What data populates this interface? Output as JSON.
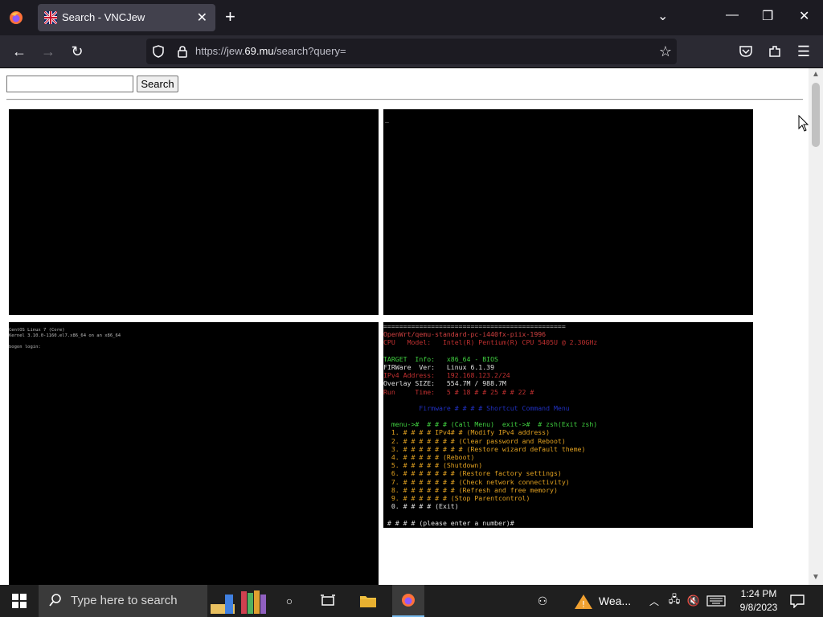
{
  "browser": {
    "tab_title": "Search - VNCJew",
    "url_prefix": "https://jew.",
    "url_domain": "69.mu",
    "url_path": "/search?query="
  },
  "page": {
    "search_input_value": "",
    "search_button_label": "Search"
  },
  "screenshots": {
    "centos_lines": [
      "CentOS Linux 7 (Core)",
      "Kernel 3.10.0-1160.el7.x86_64 on an x86_64",
      "",
      "bogon login:"
    ],
    "openwrt_lines": [
      {
        "text": "==============================================",
        "color": "#bbbbbb"
      },
      {
        "text": "OpenWrt/qemu-standard-pc-i440fx-piix-1996",
        "color": "#d04040"
      },
      {
        "text": "CPU   Model:   Intel(R) Pentium(R) CPU 5405U @ 2.30GHz",
        "color": "#c03030"
      },
      {
        "text": "                      ",
        "color": "#2020c0"
      },
      {
        "text": "TARGET  Info:   x86_64 - BIOS",
        "color": "#40d040"
      },
      {
        "text": "FIRWare  Ver:   Linux 6.1.39",
        "color": "#e0e0e0"
      },
      {
        "text": "IPv4 Address:   192.168.123.2/24",
        "color": "#c03030"
      },
      {
        "text": "Overlay SIZE:   554.7M / 988.7M",
        "color": "#e0e0e0"
      },
      {
        "text": "Run     Time:   5 # 18 # # 25 # # 22 #",
        "color": "#c03030"
      },
      {
        "text": "",
        "color": "#e0e0e0"
      },
      {
        "text": "         Firmware # # # # Shortcut Command Menu",
        "color": "#2030c0"
      },
      {
        "text": "",
        "color": "#e0e0e0"
      },
      {
        "text": "  menu->#  # # # (Call Menu)  exit->#  # zsh(Exit zsh)",
        "color": "#40d040"
      },
      {
        "text": "  1. # # # # IPv4# # (Modify IPv4 address)",
        "color": "#e0a020"
      },
      {
        "text": "  2. # # # # # # # (Clear password and Reboot)",
        "color": "#e0a020"
      },
      {
        "text": "  3. # # # # # # # # (Restore wizard default theme)",
        "color": "#e0a020"
      },
      {
        "text": "  4. # # # # # (Reboot)",
        "color": "#e0a020"
      },
      {
        "text": "  5. # # # # # (Shutdown)",
        "color": "#e0a020"
      },
      {
        "text": "  6. # # # # # # # (Restore factory settings)",
        "color": "#e0a020"
      },
      {
        "text": "  7. # # # # # # # (Check network connectivity)",
        "color": "#e0a020"
      },
      {
        "text": "  8. # # # # # # # (Refresh and free memory)",
        "color": "#e0a020"
      },
      {
        "text": "  9. # # # # # # (Stop Parentcontrol)",
        "color": "#e0a020"
      },
      {
        "text": "  0. # # # # (Exit)",
        "color": "#e0e0e0"
      },
      {
        "text": "",
        "color": "#e0e0e0"
      },
      {
        "text": " # # # # (please enter a number)#",
        "color": "#e0e0e0"
      }
    ]
  },
  "taskbar": {
    "search_placeholder": "Type here to search",
    "weather_label": "Wea...",
    "time": "1:24 PM",
    "date": "9/8/2023"
  }
}
